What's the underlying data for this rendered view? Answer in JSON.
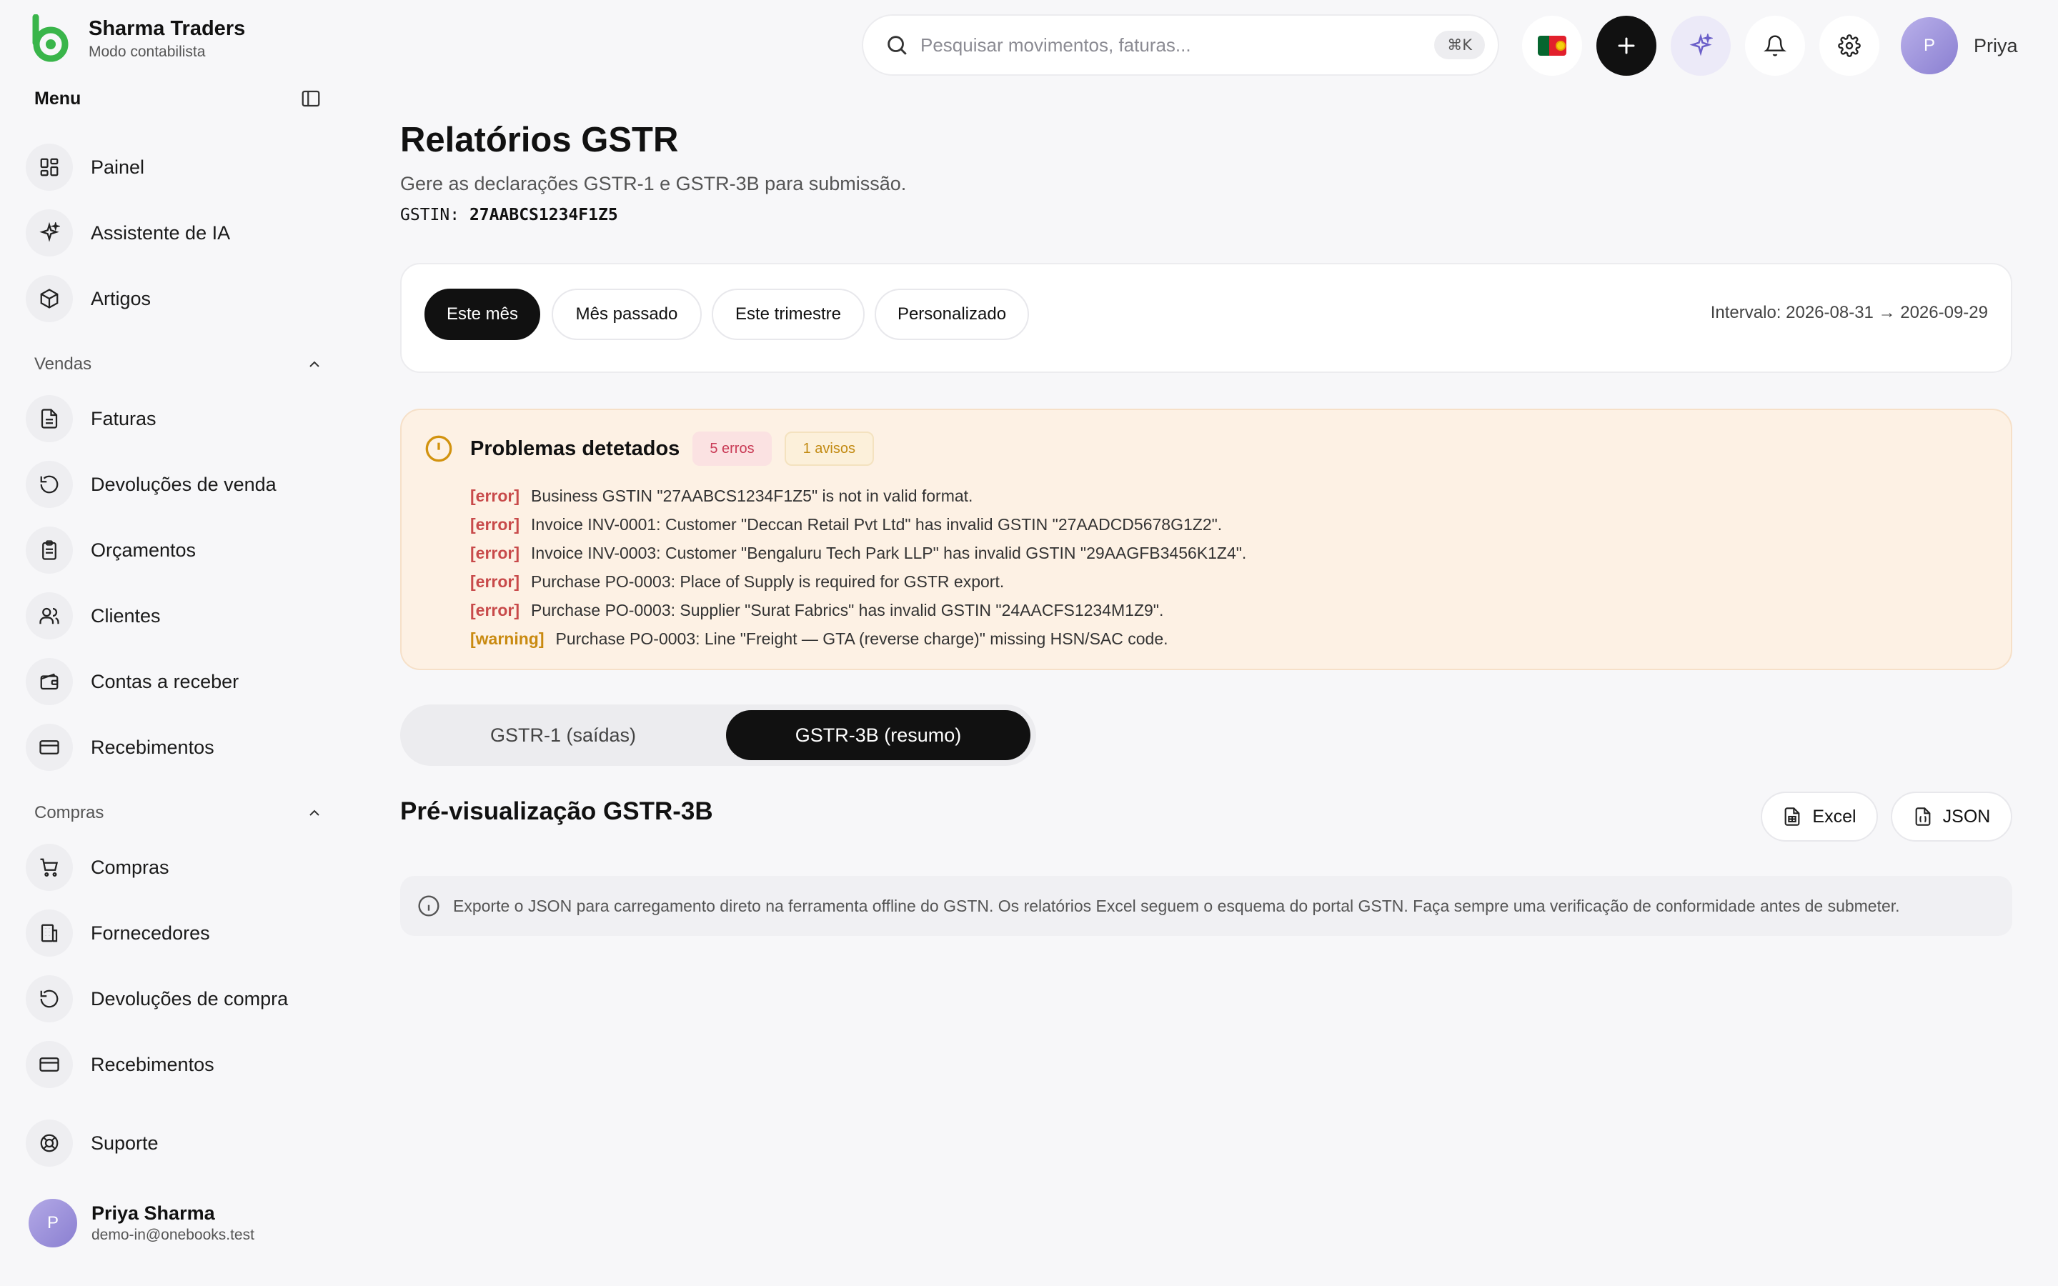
{
  "brand": {
    "name": "Sharma Traders",
    "subtitle": "Modo contabilista"
  },
  "sidebar": {
    "menu_label": "Menu",
    "top_items": [
      {
        "label": "Painel",
        "icon": "dashboard-icon"
      },
      {
        "label": "Assistente de IA",
        "icon": "sparkles-icon"
      },
      {
        "label": "Artigos",
        "icon": "box-icon"
      }
    ],
    "sales": {
      "label": "Vendas",
      "items": [
        {
          "label": "Faturas",
          "icon": "file-icon"
        },
        {
          "label": "Devoluções de venda",
          "icon": "undo-icon"
        },
        {
          "label": "Orçamentos",
          "icon": "clipboard-icon"
        },
        {
          "label": "Clientes",
          "icon": "users-icon"
        },
        {
          "label": "Contas a receber",
          "icon": "wallet-icon"
        },
        {
          "label": "Recebimentos",
          "icon": "card-icon"
        }
      ]
    },
    "purchases": {
      "label": "Compras",
      "items": [
        {
          "label": "Compras",
          "icon": "cart-icon"
        },
        {
          "label": "Fornecedores",
          "icon": "building-icon"
        },
        {
          "label": "Devoluções de compra",
          "icon": "undo-icon"
        },
        {
          "label": "Recebimentos",
          "icon": "card-icon"
        }
      ]
    },
    "support": {
      "label": "Suporte",
      "icon": "lifebuoy-icon"
    },
    "user": {
      "initial": "P",
      "name": "Priya Sharma",
      "email": "demo-in@onebooks.test"
    }
  },
  "topbar": {
    "search_placeholder": "Pesquisar movimentos, faturas...",
    "shortcut": "⌘K",
    "user_initial": "P",
    "user_name": "Priya"
  },
  "page": {
    "title": "Relatórios GSTR",
    "subtitle": "Gere as declarações GSTR-1 e GSTR-3B para submissão.",
    "gstin_label": "GSTIN:",
    "gstin_value": "27AABCS1234F1Z5"
  },
  "period": {
    "options": [
      "Este mês",
      "Mês passado",
      "Este trimestre",
      "Personalizado"
    ],
    "active_index": 0,
    "range": "Intervalo: 2026-08-31 → 2026-09-29"
  },
  "issues": {
    "title": "Problemas detetados",
    "errors_badge": "5 erros",
    "warnings_badge": "1 avisos",
    "items": [
      {
        "tag": "[error]",
        "text": "Business GSTIN \"27AABCS1234F1Z5\" is not in valid format."
      },
      {
        "tag": "[error]",
        "text": "Invoice INV-0001: Customer \"Deccan Retail Pvt Ltd\" has invalid GSTIN \"27AADCD5678G1Z2\"."
      },
      {
        "tag": "[error]",
        "text": "Invoice INV-0003: Customer \"Bengaluru Tech Park LLP\" has invalid GSTIN \"29AAGFB3456K1Z4\"."
      },
      {
        "tag": "[error]",
        "text": "Purchase PO-0003: Place of Supply is required for GSTR export."
      },
      {
        "tag": "[error]",
        "text": "Purchase PO-0003: Supplier \"Surat Fabrics\" has invalid GSTIN \"24AACFS1234M1Z9\"."
      },
      {
        "tag": "[warning]",
        "text": "Purchase PO-0003: Line \"Freight — GTA (reverse charge)\" missing HSN/SAC code."
      }
    ]
  },
  "report_tabs": {
    "gstr1": "GSTR-1 (saídas)",
    "gstr3b": "GSTR-3B (resumo)"
  },
  "preview": {
    "title": "Pré-visualização GSTR-3B",
    "excel": "Excel",
    "json": "JSON"
  },
  "info": {
    "text": "Exporte o JSON para carregamento direto na ferramenta offline do GSTN. Os relatórios Excel seguem o esquema do portal GSTN. Faça sempre uma verificação de conformidade antes de submeter."
  },
  "colors": {
    "brand_green": "#39b54a",
    "error": "#c84a4a",
    "warning": "#c98a10",
    "issues_bg": "#fdf1e4"
  }
}
